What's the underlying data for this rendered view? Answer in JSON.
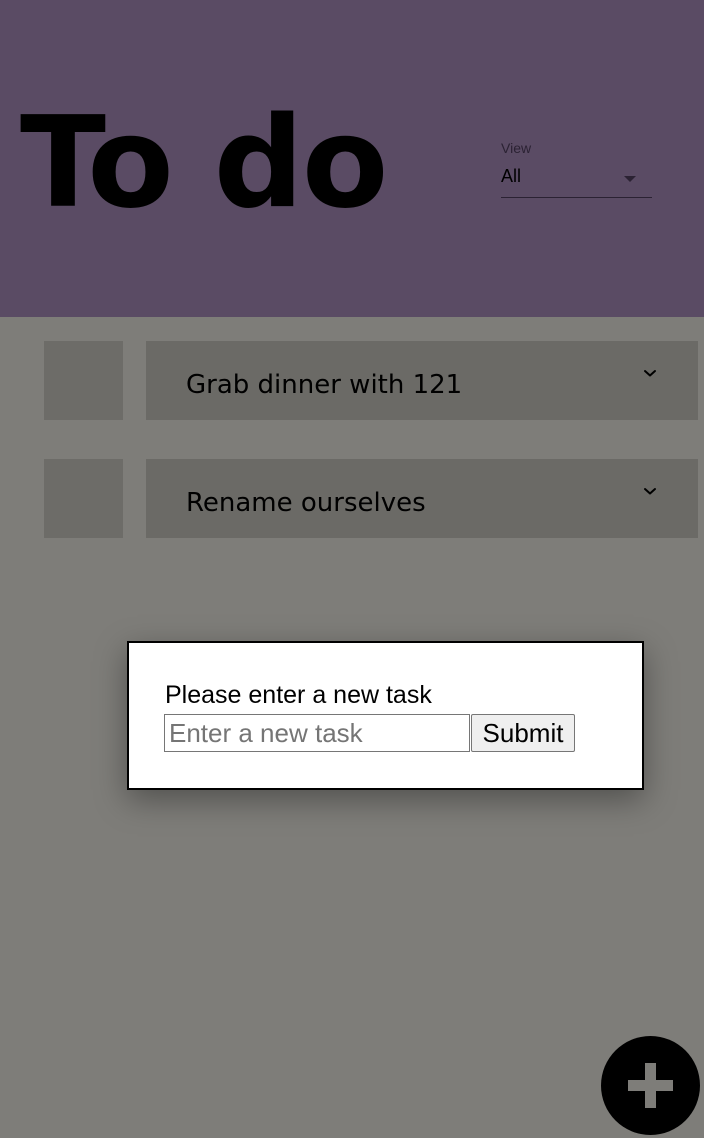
{
  "header": {
    "title": "To do",
    "background_color": "#5a4b64"
  },
  "view_filter": {
    "label": "View",
    "selected": "All"
  },
  "tasks": [
    {
      "text": "Grab dinner with 121",
      "expand_icon": "chevron-down-icon"
    },
    {
      "text": "Rename ourselves",
      "expand_icon": "chevron-down-icon"
    }
  ],
  "modal": {
    "prompt": "Please enter a new task",
    "input_placeholder": "Enter a new task",
    "input_value": "",
    "submit_label": "Submit"
  },
  "fab": {
    "icon": "plus-icon"
  }
}
